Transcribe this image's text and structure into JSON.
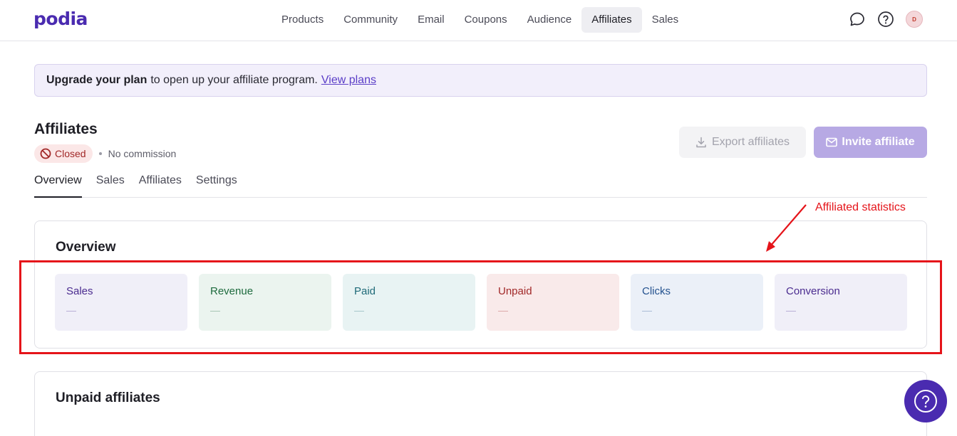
{
  "brand": {
    "logo": "podia",
    "color": "#4a2bb0"
  },
  "nav": {
    "items": [
      {
        "label": "Products"
      },
      {
        "label": "Community"
      },
      {
        "label": "Email"
      },
      {
        "label": "Coupons"
      },
      {
        "label": "Audience"
      },
      {
        "label": "Affiliates",
        "active": true
      },
      {
        "label": "Sales"
      }
    ],
    "icons": [
      "chat-icon",
      "help-icon"
    ],
    "avatar_initial": "D"
  },
  "banner": {
    "strong": "Upgrade your plan",
    "text": "to open up your affiliate program.",
    "link": "View plans"
  },
  "header": {
    "title": "Affiliates",
    "status": "Closed",
    "commission": "No commission",
    "export_label": "Export affiliates",
    "invite_label": "Invite affiliate"
  },
  "tabs": [
    {
      "label": "Overview",
      "active": true
    },
    {
      "label": "Sales"
    },
    {
      "label": "Affiliates"
    },
    {
      "label": "Settings"
    }
  ],
  "overview": {
    "title": "Overview",
    "stats": [
      {
        "label": "Sales",
        "value": "—",
        "bg": "#f0eff8",
        "color": "#4a2b8f"
      },
      {
        "label": "Revenue",
        "value": "—",
        "bg": "#ebf4ef",
        "color": "#1e6b3e"
      },
      {
        "label": "Paid",
        "value": "—",
        "bg": "#e8f3f3",
        "color": "#1f6a78"
      },
      {
        "label": "Unpaid",
        "value": "—",
        "bg": "#f9eaea",
        "color": "#a12828"
      },
      {
        "label": "Clicks",
        "value": "—",
        "bg": "#ebf0f8",
        "color": "#24528f"
      },
      {
        "label": "Conversion",
        "value": "—",
        "bg": "#f0eff8",
        "color": "#4a2b8f"
      }
    ]
  },
  "annotation": {
    "text": "Affiliated statistics",
    "color": "#e5141a"
  },
  "unpaid": {
    "title": "Unpaid affiliates"
  }
}
